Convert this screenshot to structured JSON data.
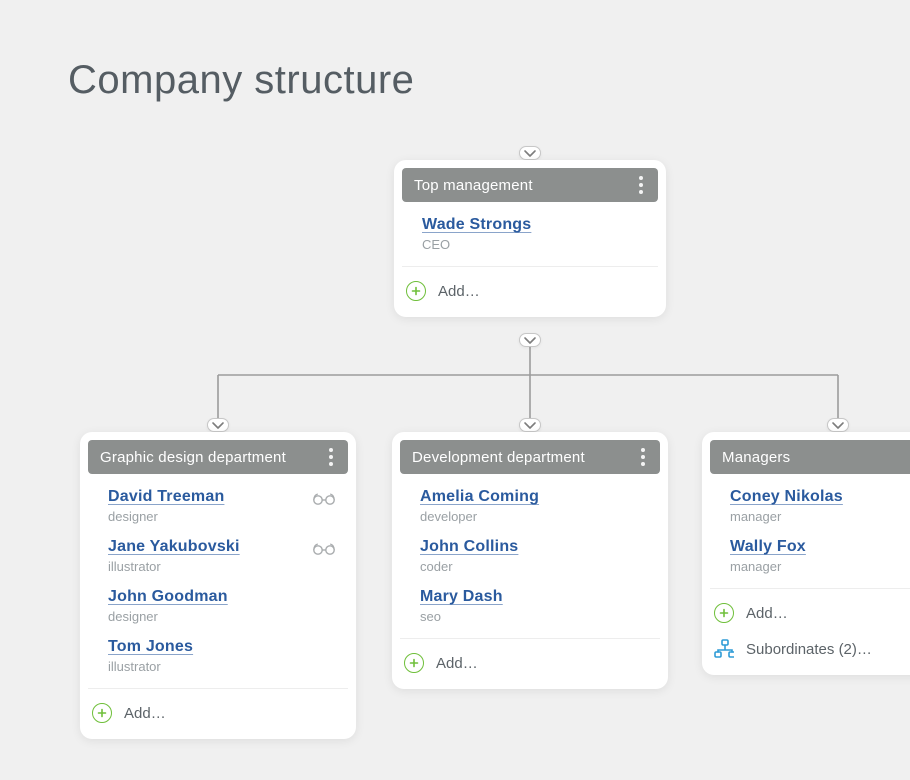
{
  "page_title": "Company structure",
  "add_label": "Add…",
  "subordinates_label": "Subordinates (2)…",
  "cards": {
    "top": {
      "title": "Top management",
      "people": [
        {
          "name": "Wade Strongs",
          "role": "CEO",
          "glasses": false
        }
      ]
    },
    "design": {
      "title": "Graphic design department",
      "people": [
        {
          "name": "David Treeman",
          "role": "designer",
          "glasses": true
        },
        {
          "name": "Jane Yakubovski",
          "role": "illustrator",
          "glasses": true
        },
        {
          "name": "John Goodman",
          "role": "designer",
          "glasses": false
        },
        {
          "name": "Tom Jones",
          "role": "illustrator",
          "glasses": false
        }
      ]
    },
    "dev": {
      "title": "Development department",
      "people": [
        {
          "name": "Amelia Coming",
          "role": "developer",
          "glasses": false
        },
        {
          "name": "John Collins",
          "role": "coder",
          "glasses": false
        },
        {
          "name": "Mary Dash",
          "role": "seo",
          "glasses": false
        }
      ]
    },
    "managers": {
      "title": "Managers",
      "people": [
        {
          "name": "Coney Nikolas",
          "role": "manager",
          "glasses": false
        },
        {
          "name": "Wally Fox",
          "role": "manager",
          "glasses": false
        }
      ]
    }
  }
}
